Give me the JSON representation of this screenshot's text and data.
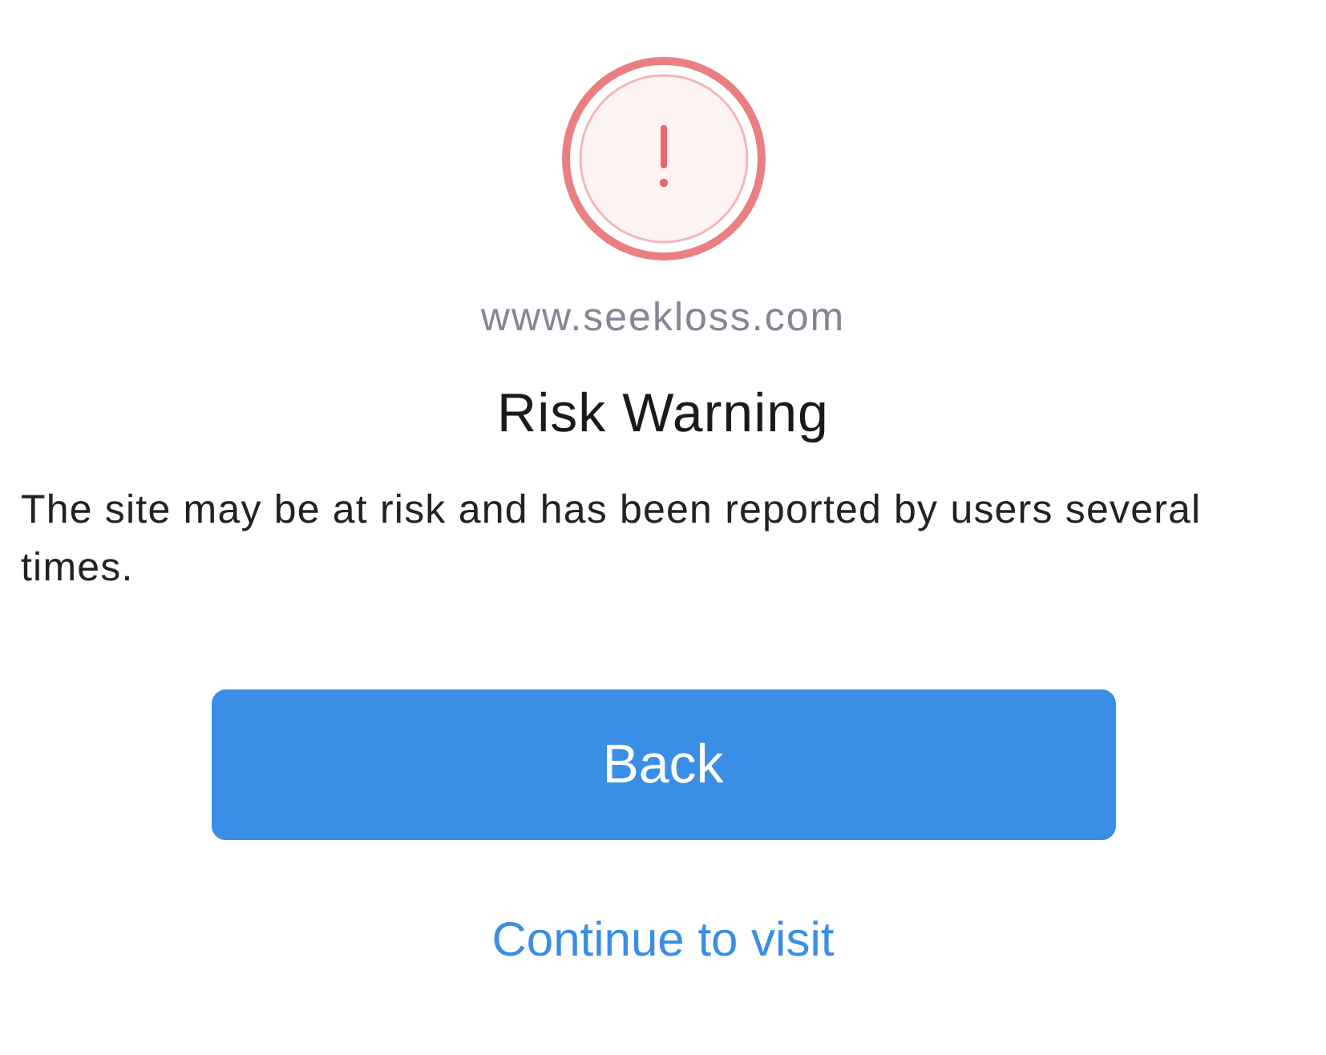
{
  "site": "www.seekloss.com",
  "title": "Risk Warning",
  "message": "The site may be at risk and has been reported by users several times.",
  "primary_button": "Back",
  "secondary_link": "Continue to visit"
}
